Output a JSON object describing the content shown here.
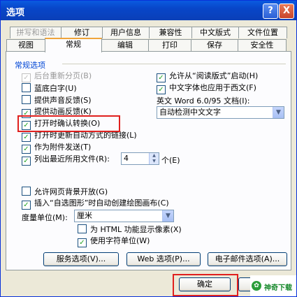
{
  "window": {
    "title": "选项",
    "help_symbol": "?",
    "close_symbol": "X"
  },
  "tabs_row1": [
    "拼写和语法",
    "修订",
    "用户信息",
    "兼容性",
    "中文版式",
    "文件位置"
  ],
  "tabs_row2": [
    "视图",
    "常规",
    "编辑",
    "打印",
    "保存",
    "安全性"
  ],
  "group_title": "常规选项",
  "left_options": [
    {
      "label": "后台重新分页(B)",
      "checked": true,
      "disabled": true
    },
    {
      "label": "蓝底白字(U)",
      "checked": false,
      "disabled": false
    },
    {
      "label": "提供声音反馈(S)",
      "checked": false,
      "disabled": false
    },
    {
      "label": "提供动画反馈(K)",
      "checked": true,
      "disabled": false
    },
    {
      "label": "打开时确认转换(O)",
      "checked": true,
      "disabled": false
    },
    {
      "label": "打开时更新自动方式的链接(L)",
      "checked": true,
      "disabled": false
    },
    {
      "label": "作为附件发送(T)",
      "checked": true,
      "disabled": false
    },
    {
      "label": "列出最近所用文件(R):",
      "checked": true,
      "disabled": false
    }
  ],
  "right_options": [
    {
      "label": "允许从“阅读版式”启动(H)",
      "checked": true
    },
    {
      "label": "中文字体也应用于西文(F)",
      "checked": true
    }
  ],
  "word_text_label": "英文 Word 6.0/95 文档(I):",
  "word_text_value": "自动检测中文文字",
  "recent_count": "4",
  "recent_unit": "个(E)",
  "lower_options": [
    {
      "label": "允许网页背景开放(G)",
      "checked": false
    },
    {
      "label": "插入“自选图形”时自动创建绘图画布(C)",
      "checked": true
    }
  ],
  "unit_label": "度量单位(M):",
  "unit_value": "厘米",
  "sub_options": [
    {
      "label": "为 HTML 功能显示像素(X)",
      "checked": false
    },
    {
      "label": "使用字符单位(W)",
      "checked": true
    }
  ],
  "buttons": {
    "service": "服务选项(V)...",
    "web": "Web 选项(P)...",
    "email": "电子邮件选项(A)...",
    "ok": "确定"
  },
  "logo_text": "神奇下载",
  "colors": {
    "highlight": "#e0201e",
    "titlebar": "#0846c8",
    "group_label": "#0046d5"
  }
}
